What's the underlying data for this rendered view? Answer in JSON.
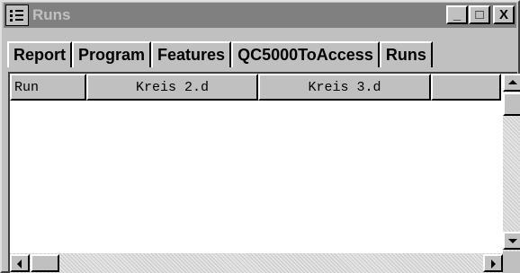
{
  "window": {
    "title": "Runs",
    "minimize_label": "_",
    "maximize_label": "□",
    "close_label": "X"
  },
  "tabs": [
    {
      "label": "Report"
    },
    {
      "label": "Program"
    },
    {
      "label": "Features"
    },
    {
      "label": "QC5000ToAccess"
    },
    {
      "label": "Runs"
    }
  ],
  "grid": {
    "columns": [
      "Run",
      "Kreis 2.d",
      "Kreis 3.d",
      ""
    ],
    "rows": []
  },
  "colors": {
    "title_bar": "#808080",
    "face": "#c0c0c0",
    "grid_background": "#ffffff"
  },
  "icons": [
    "app-list-icon",
    "scroll-up-arrow-icon",
    "scroll-down-arrow-icon",
    "scroll-left-arrow-icon",
    "scroll-right-arrow-icon"
  ]
}
